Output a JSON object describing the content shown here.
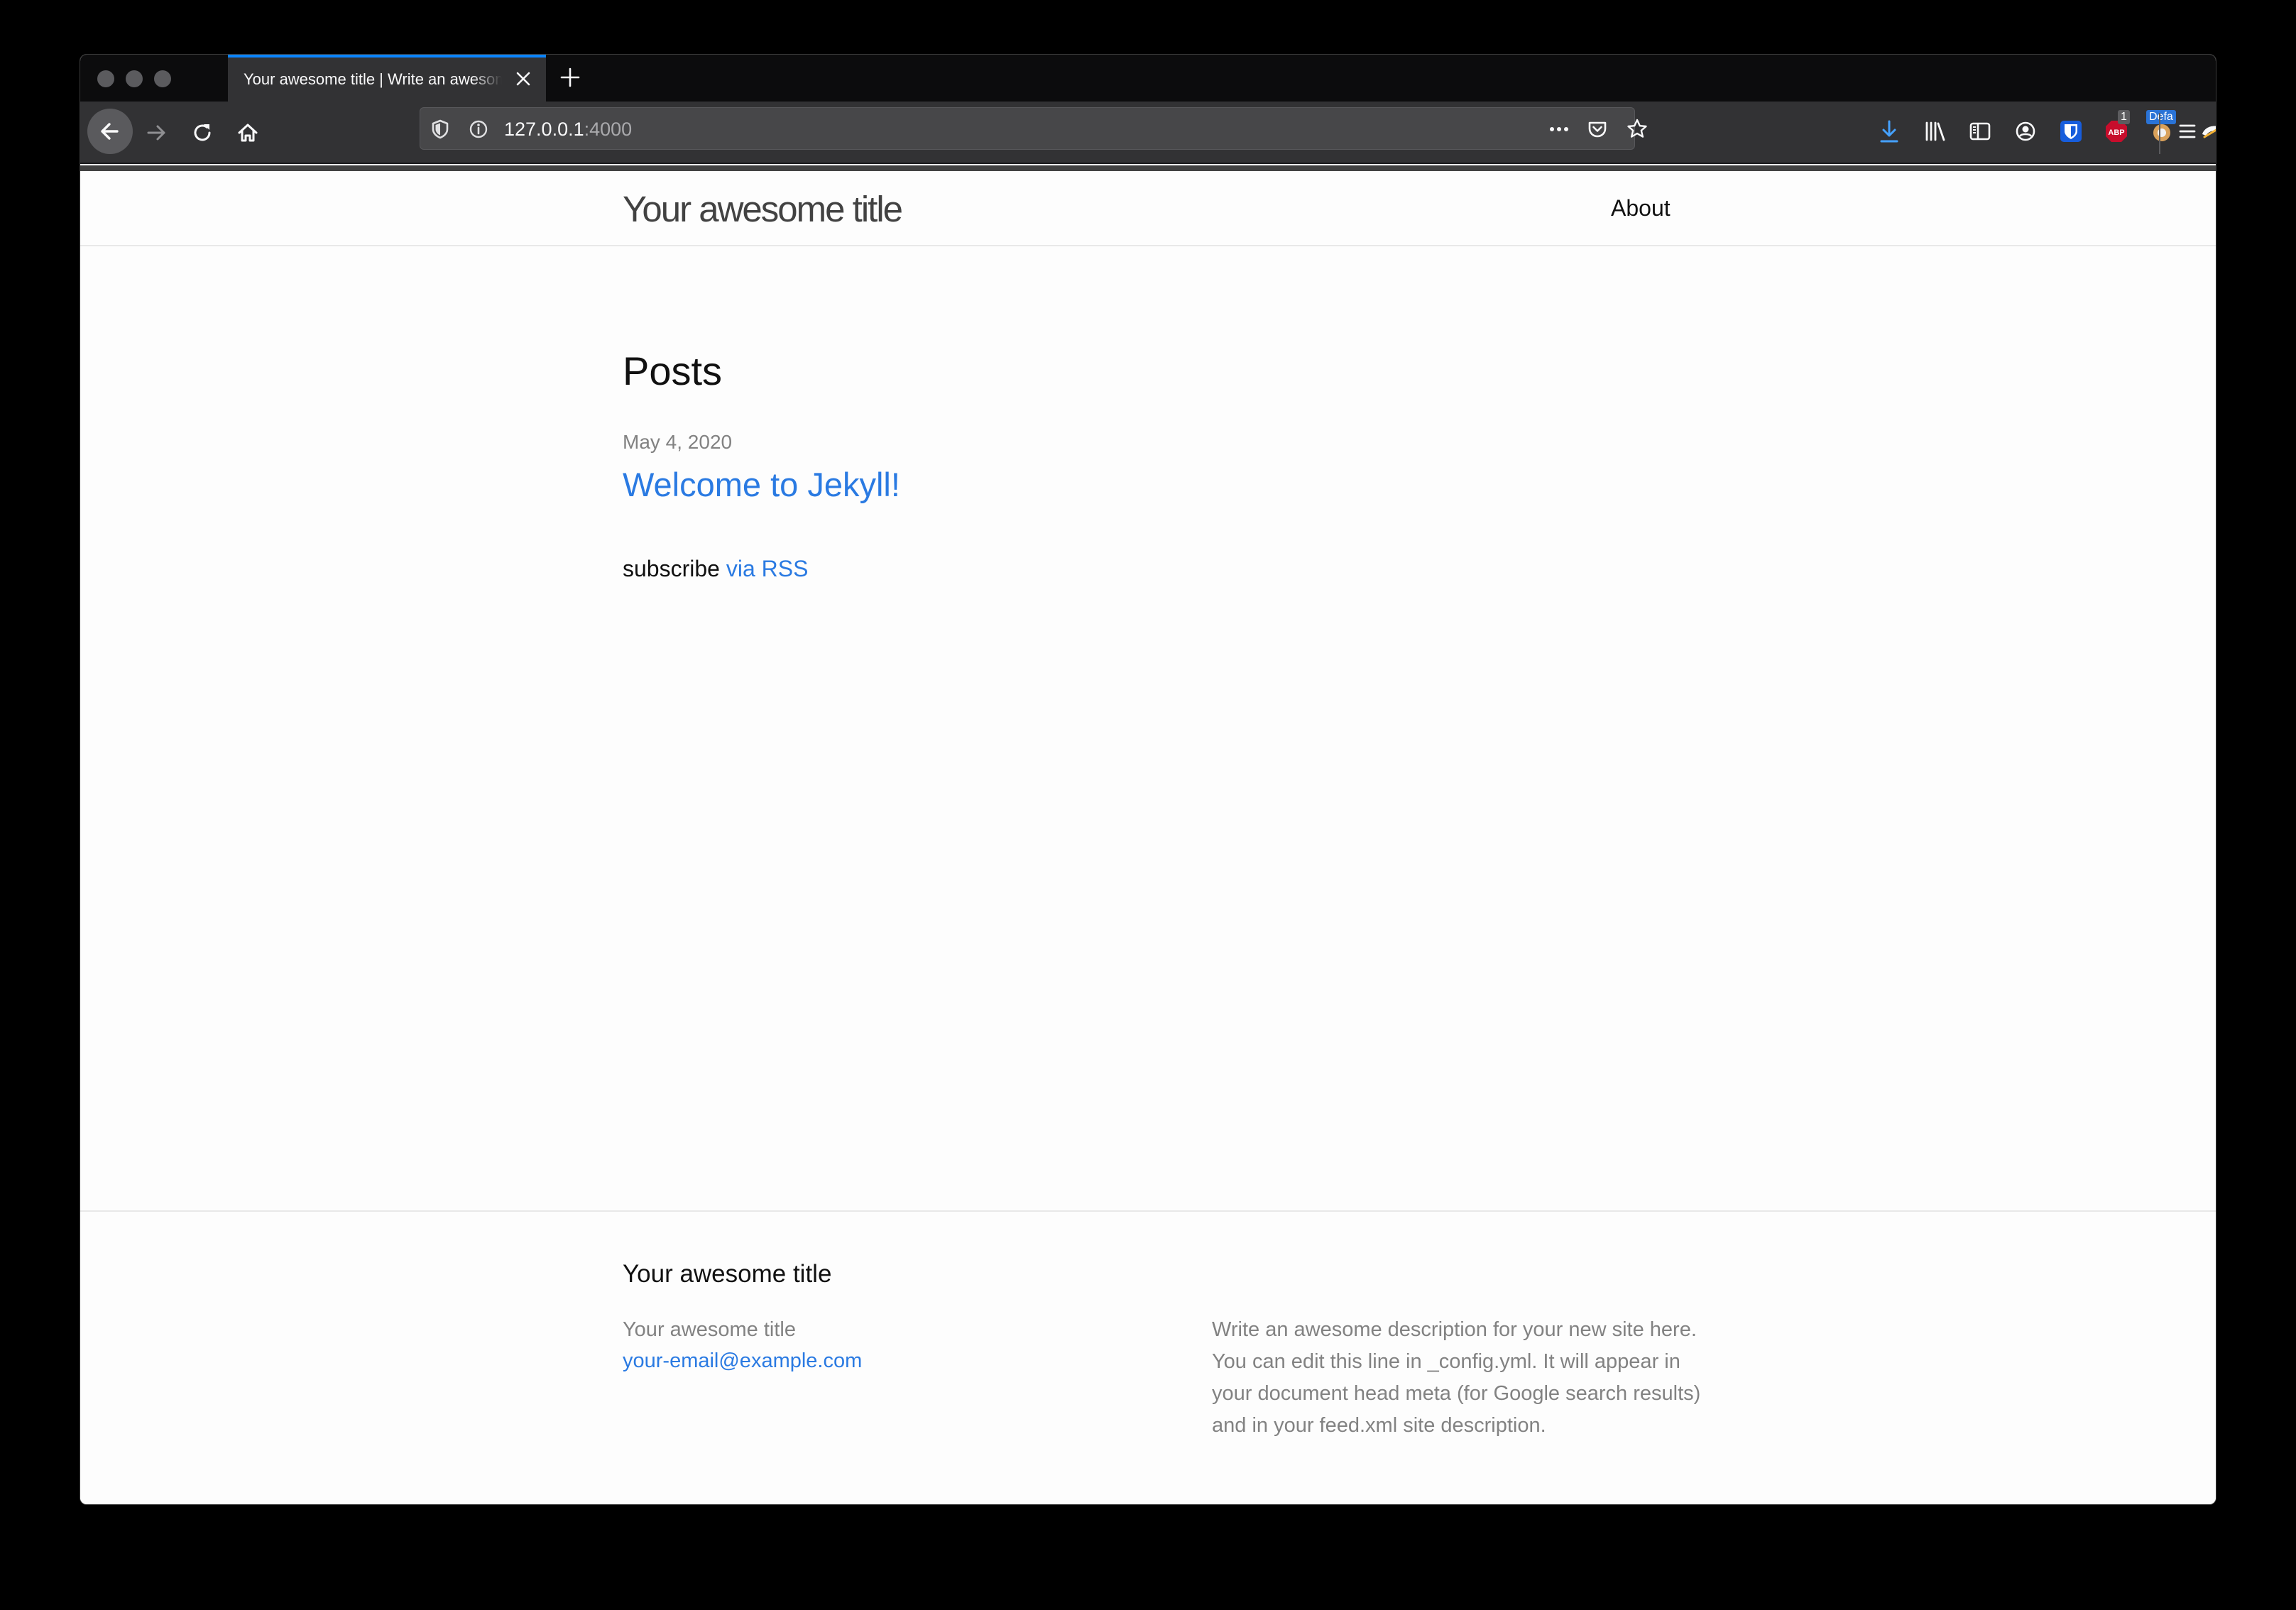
{
  "browser": {
    "tab": {
      "title": "Your awesome title | Write an awesome description for your new site here."
    },
    "url": {
      "host": "127.0.0.1",
      "port": ":4000"
    },
    "extensions": {
      "abp_badge": "1",
      "container_badge": "Defa"
    },
    "accent_color": "#0a84ff"
  },
  "site": {
    "title": "Your awesome title",
    "nav": {
      "about": "About"
    }
  },
  "main": {
    "heading": "Posts",
    "posts": [
      {
        "date": "May 4, 2020",
        "title": "Welcome to Jekyll!"
      }
    ],
    "subscribe": {
      "prefix": "subscribe",
      "link": "via RSS"
    }
  },
  "footer": {
    "heading": "Your awesome title",
    "name": "Your awesome title",
    "email": "your-email@example.com",
    "description": "Write an awesome description for your new site here. You can edit this line in _config.yml. It will appear in your document head meta (for Google search results) and in your feed.xml site description."
  },
  "colors": {
    "link": "#2a7ae2",
    "meta_text": "#828282",
    "title_text": "#424242"
  }
}
